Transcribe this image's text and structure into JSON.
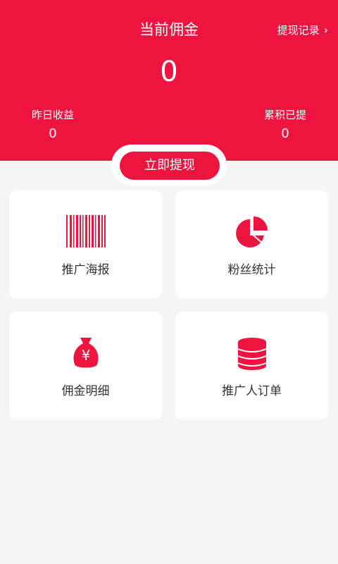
{
  "header": {
    "title": "当前佣金",
    "records_label": "提现记录",
    "amount": "0",
    "yesterday_label": "昨日收益",
    "yesterday_value": "0",
    "total_label": "累积已提",
    "total_value": "0",
    "withdraw_label": "立即提现"
  },
  "cards": [
    {
      "label": "推广海报",
      "icon": "barcode-icon"
    },
    {
      "label": "粉丝统计",
      "icon": "pie-chart-icon"
    },
    {
      "label": "佣金明细",
      "icon": "money-bag-icon"
    },
    {
      "label": "推广人订单",
      "icon": "coin-stack-icon"
    }
  ],
  "colors": {
    "primary": "#ee1440",
    "background": "#f5f5f5"
  }
}
